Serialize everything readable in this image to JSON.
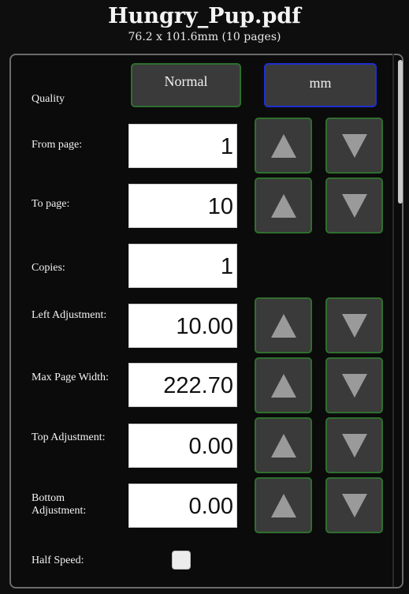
{
  "header": {
    "title": "Hungry_Pup.pdf",
    "subtitle": "76.2 x 101.6mm (10 pages)"
  },
  "quality": {
    "label": "Quality",
    "value": "Normal",
    "unit": "mm"
  },
  "fields": [
    {
      "label": "From page:",
      "value": "1"
    },
    {
      "label": "To page:",
      "value": "10"
    },
    {
      "label": "Copies:",
      "value": "1"
    },
    {
      "label": "Left Adjustment:",
      "value": "10.00"
    },
    {
      "label": "Max Page Width:",
      "value": "222.70"
    },
    {
      "label": "Top Adjustment:",
      "value": "0.00"
    },
    {
      "label": "Bottom Adjustment:",
      "value": "0.00"
    }
  ],
  "half_speed": {
    "label": "Half Speed:",
    "checked": false
  },
  "icons": {
    "up": "arrow-up-icon",
    "down": "arrow-down-icon"
  },
  "colors": {
    "button_border_green": "#2f6e2f",
    "unit_border_blue": "#1f2fd0",
    "button_bg": "#3a3a3a",
    "background": "#0e0e0e"
  }
}
